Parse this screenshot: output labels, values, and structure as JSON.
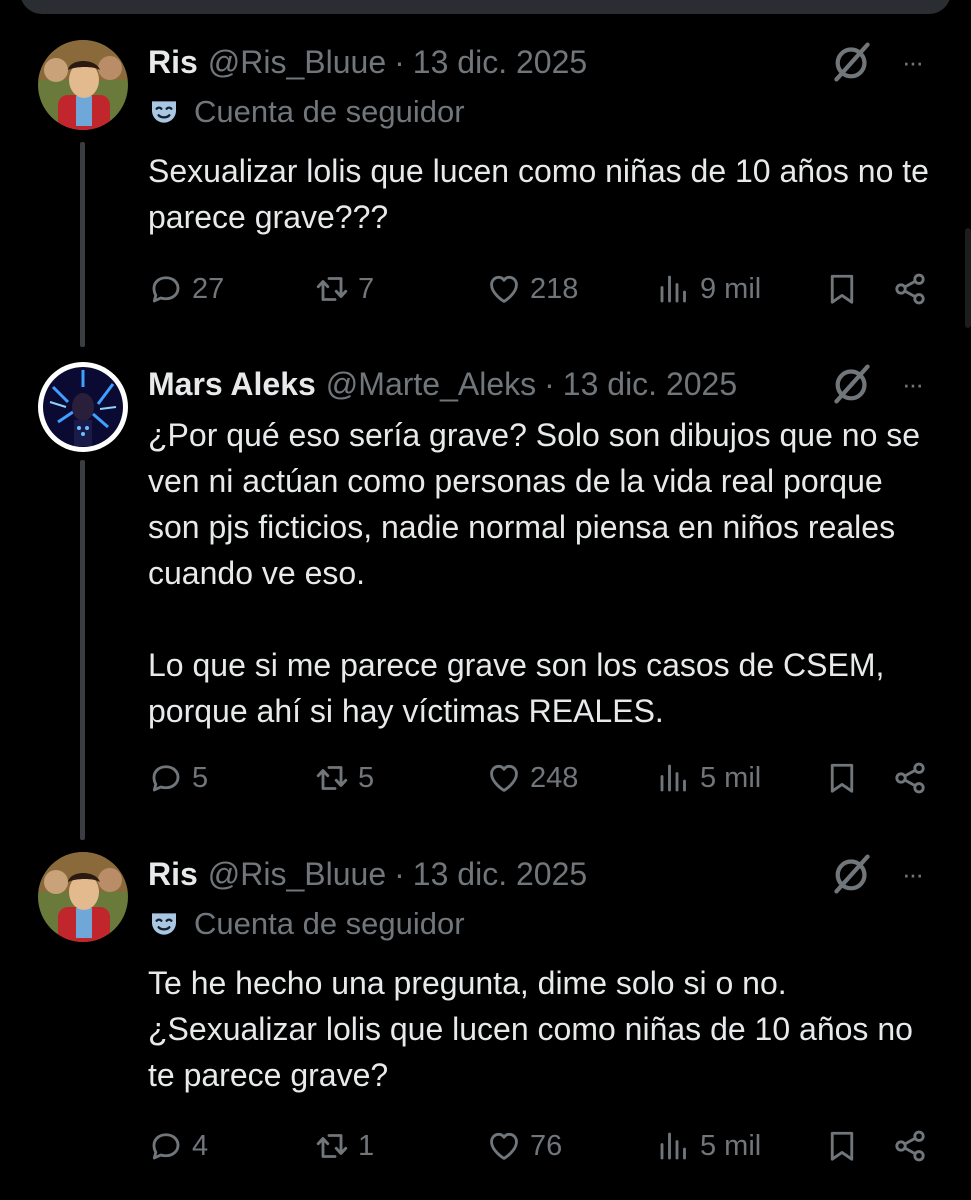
{
  "tweets": [
    {
      "name": "Ris",
      "handle": "@Ris_Bluue",
      "separator": "·",
      "date": "13 dic. 2025",
      "follower_label": "Cuenta de seguidor",
      "text": "Sexualizar lolis que lucen como niñas de 10 años no te parece grave???",
      "replies": "27",
      "retweets": "7",
      "likes": "218",
      "views": "9 mil",
      "more": "···"
    },
    {
      "name": "Mars Aleks",
      "handle": "@Marte_Aleks",
      "separator": "·",
      "date": "13 dic. 2025",
      "text": "¿Por qué eso sería grave? Solo son dibujos que no se ven ni actúan como personas de la vida real porque son pjs ficticios, nadie normal piensa en niños reales cuando ve eso.\n\nLo que si me parece grave son los casos de CSEM, porque ahí si hay víctimas REALES.",
      "replies": "5",
      "retweets": "5",
      "likes": "248",
      "views": "5 mil",
      "more": "···"
    },
    {
      "name": "Ris",
      "handle": "@Ris_Bluue",
      "separator": "·",
      "date": "13 dic. 2025",
      "follower_label": "Cuenta de seguidor",
      "text": "Te he hecho una pregunta, dime solo si o no. ¿Sexualizar lolis que lucen como niñas de 10 años no te parece grave?",
      "replies": "4",
      "retweets": "1",
      "likes": "76",
      "views": "5 mil",
      "more": "···"
    }
  ],
  "icons": {
    "reply": "reply-icon",
    "retweet": "retweet-icon",
    "like": "heart-icon",
    "views": "views-icon",
    "bookmark": "bookmark-icon",
    "share": "share-icon",
    "grok": "grok-icon",
    "more": "more-icon",
    "follower": "theater-mask-icon"
  },
  "colors": {
    "background": "#000000",
    "text": "#e7e9ea",
    "muted": "#71767b",
    "thread_line": "#3a3d41"
  }
}
